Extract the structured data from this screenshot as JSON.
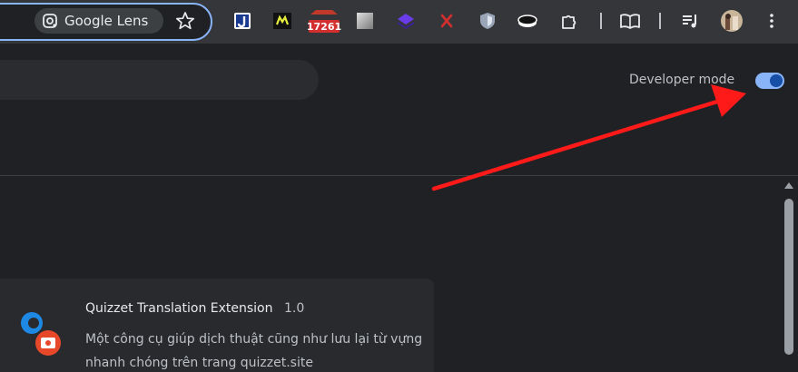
{
  "toolbar": {
    "lens_label": "Google Lens",
    "extension_icons": [
      "jtag-extension-icon",
      "m-lightning-extension-icon",
      "ublock-badge-extension-icon",
      "grey-square-extension-icon",
      "purple-layers-extension-icon",
      "red-x-extension-icon",
      "shield-extension-icon",
      "black-puck-extension-icon",
      "puzzle-icon",
      "reading-list-icon",
      "media-queue-icon",
      "avatar",
      "kebab-menu-icon"
    ],
    "badge_count": "17261"
  },
  "header": {
    "developer_mode_label": "Developer mode",
    "developer_mode_on": true
  },
  "extension_card": {
    "name": "Quizzet Translation Extension",
    "version": "1.0",
    "description": "Một công cụ giúp dịch thuật cũng như lưu lại từ vựng nhanh chóng trên trang quizzet.site"
  },
  "colors": {
    "accent": "#8ab4f8",
    "annotation_arrow": "#ff1a1a"
  }
}
